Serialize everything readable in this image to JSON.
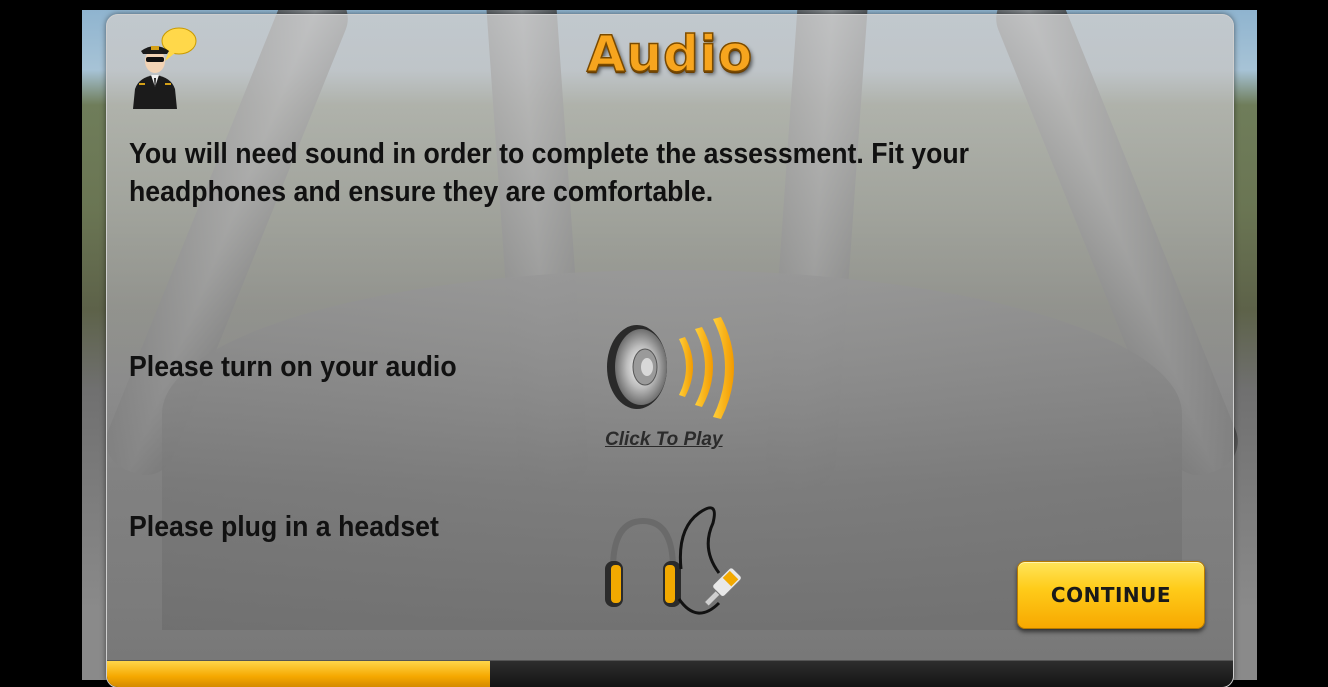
{
  "screen": {
    "title": "Audio",
    "intro_text": "You will need sound in order to complete the assessment. Fit your headphones and ensure they are comfortable.",
    "audio_label": "Please turn on your audio",
    "click_to_play": "Click To Play",
    "headset_label": "Please plug in a headset",
    "continue_label": "CONTINUE"
  },
  "progress": {
    "fraction": 0.34
  },
  "icons": {
    "pilot": "pilot-avatar-icon",
    "speaker": "speaker-icon",
    "headset": "headphones-icon"
  },
  "colors": {
    "title": "#f7a51e",
    "button": "#ffcc1a",
    "progress": "#f5a800",
    "speech_bubble": "#ffd84a"
  }
}
